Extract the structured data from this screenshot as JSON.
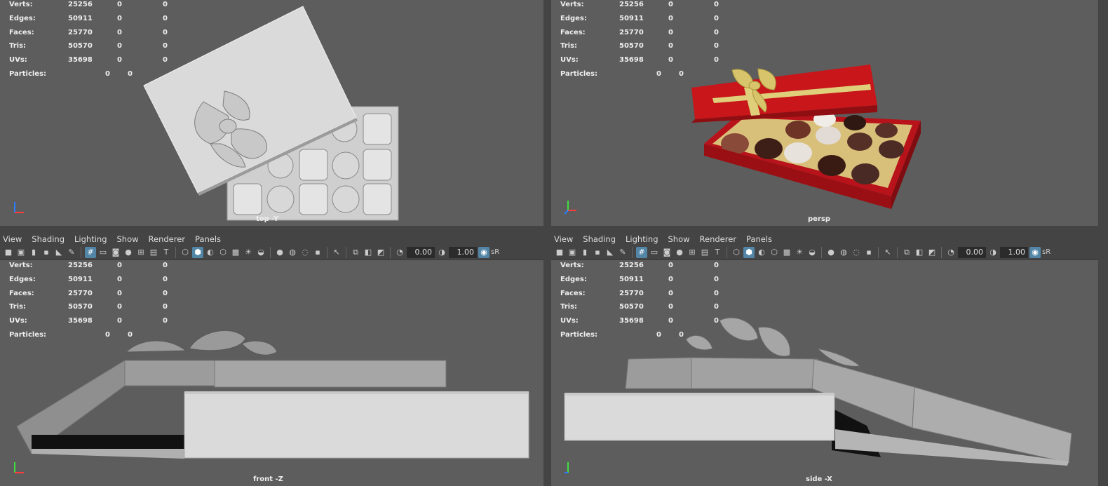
{
  "hud": {
    "verts": {
      "label": "Verts:",
      "a": "25256",
      "b": "0",
      "c": "0"
    },
    "edges": {
      "label": "Edges:",
      "a": "50911",
      "b": "0",
      "c": "0"
    },
    "faces": {
      "label": "Faces:",
      "a": "25770",
      "b": "0",
      "c": "0"
    },
    "tris": {
      "label": "Tris:",
      "a": "50570",
      "b": "0",
      "c": "0"
    },
    "uvs": {
      "label": "UVs:",
      "a": "35698",
      "b": "0",
      "c": "0"
    },
    "particles": {
      "label": "Particles:",
      "a": "0",
      "b": "0"
    }
  },
  "menu": {
    "view": "View",
    "shading": "Shading",
    "lighting": "Lighting",
    "show": "Show",
    "renderer": "Renderer",
    "panels": "Panels"
  },
  "toolbar": {
    "exposure": "0.00",
    "gamma": "1.00",
    "colorspace": "sR"
  },
  "cameras": {
    "top": "top -Y",
    "persp": "persp",
    "front": "front -Z",
    "side": "side -X"
  },
  "icons": [
    "camera-icon",
    "grid-icon",
    "wireframe-icon",
    "smooth-shade-icon",
    "texture-icon",
    "light-icon",
    "xray-icon",
    "isolate-icon",
    "select-icon"
  ],
  "colors": {
    "viewport_bg": "#5d5d5d",
    "box_red": "#c8161a",
    "ribbon_gold": "#d8c46a",
    "active_blue": "#5285a6"
  }
}
